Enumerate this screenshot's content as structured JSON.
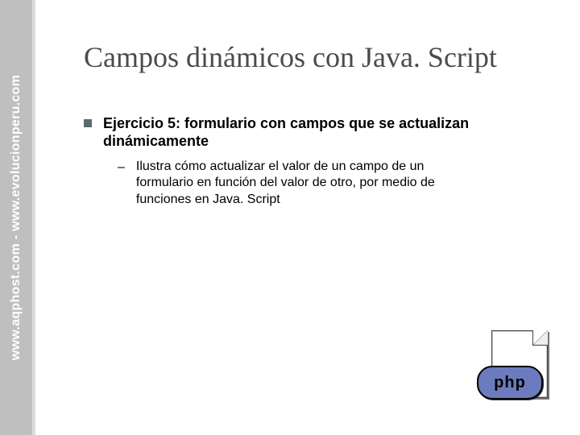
{
  "sidebar": {
    "text": "www.aqphost.com - www.evolucionperu.com"
  },
  "slide": {
    "title": "Campos dinámicos con Java. Script",
    "bullet1": "Ejercicio 5: formulario con campos que se actualizan dinámicamente",
    "bullet2_dash": "–",
    "bullet2": "Ilustra cómo actualizar el valor de un campo de un formulario en función del valor de otro, por medio de funciones en Java. Script"
  },
  "icon": {
    "label": "php"
  }
}
